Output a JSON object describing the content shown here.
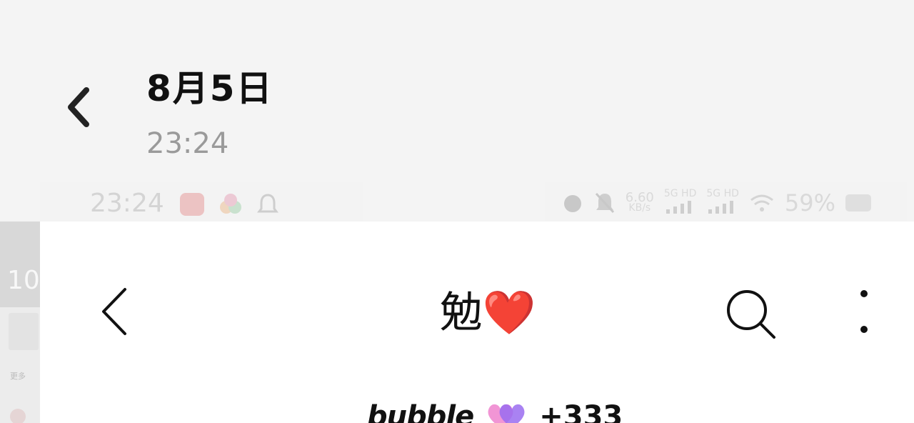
{
  "viewer": {
    "date": "8月5日",
    "time": "23:24",
    "back_icon": "chevron-left-icon"
  },
  "status_bar": {
    "time": "23:24",
    "network_speed_value": "6.60",
    "network_speed_unit": "KB/s",
    "sim1_label": "5G HD",
    "sim2_label": "5G HD",
    "battery": "59%",
    "icons": [
      "app-notification-icon",
      "app-icon",
      "bell-icon",
      "alarm-icon",
      "mute-icon",
      "signal-icon",
      "wifi-icon",
      "battery-icon"
    ]
  },
  "thumbnails": {
    "number": "10",
    "caption": "更多"
  },
  "chat": {
    "title": "勉❤️",
    "back_icon": "chevron-left-icon",
    "search_icon": "search-icon",
    "more_icon": "more-vertical-icon",
    "brand": "bubble",
    "count": "+333",
    "colors": {
      "heart_pink": "#f08ad0",
      "heart_purple": "#9a6cf0"
    }
  }
}
